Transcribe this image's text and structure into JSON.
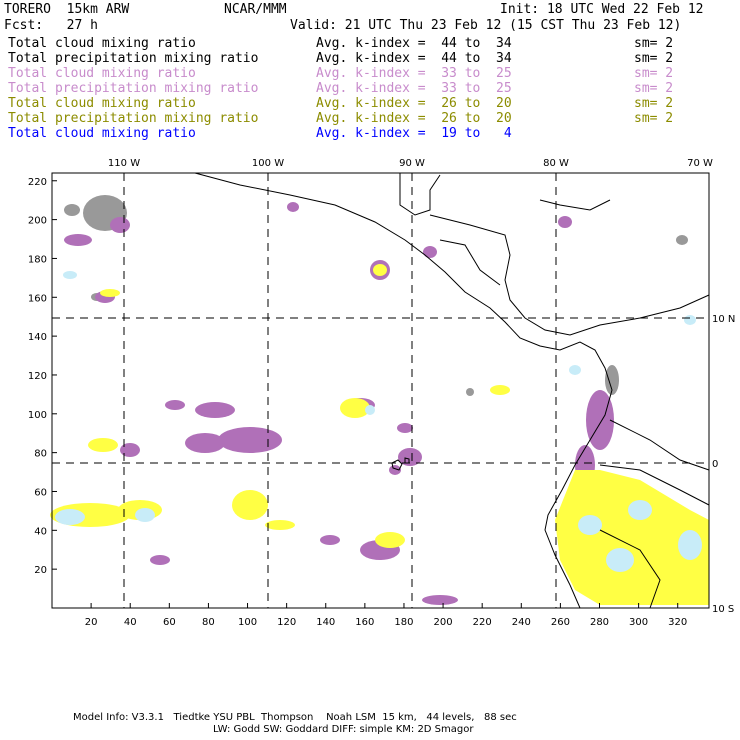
{
  "header": {
    "model": "TORERO  15km ARW",
    "org": "NCAR/MMM",
    "init": "Init: 18 UTC Wed 22 Feb 12",
    "fcst": "Fcst:   27 h",
    "valid": "Valid: 21 UTC Thu 23 Feb 12 (15 CST Thu 23 Feb 12)"
  },
  "legend": [
    {
      "field": "Total cloud mixing ratio",
      "range": "Avg. k-index =  44 to  34",
      "sm": "sm= 2",
      "color": "#000000"
    },
    {
      "field": "Total precipitation mixing ratio",
      "range": "Avg. k-index =  44 to  34",
      "sm": "sm= 2",
      "color": "#000000"
    },
    {
      "field": "Total cloud mixing ratio",
      "range": "Avg. k-index =  33 to  25",
      "sm": "sm= 2",
      "color": "#c88ccc"
    },
    {
      "field": "Total precipitation mixing ratio",
      "range": "Avg. k-index =  33 to  25",
      "sm": "sm= 2",
      "color": "#c88ccc"
    },
    {
      "field": "Total cloud mixing ratio",
      "range": "Avg. k-index =  26 to  20",
      "sm": "sm= 2",
      "color": "#8c8c00"
    },
    {
      "field": "Total precipitation mixing ratio",
      "range": "Avg. k-index =  26 to  20",
      "sm": "sm= 2",
      "color": "#8c8c00"
    },
    {
      "field": "Total cloud mixing ratio",
      "range": "Avg. k-index =  19 to   4",
      "sm": "",
      "color": "#0000ff"
    }
  ],
  "chart_data": {
    "type": "heatmap",
    "title": "Total cloud / precipitation mixing ratio by k-index layer",
    "x_ticks": [
      20,
      40,
      60,
      80,
      100,
      120,
      140,
      160,
      180,
      200,
      220,
      240,
      260,
      280,
      300,
      320
    ],
    "y_ticks": [
      20,
      40,
      60,
      80,
      100,
      120,
      140,
      160,
      180,
      200,
      220
    ],
    "xlim": [
      0,
      336
    ],
    "ylim": [
      0,
      224
    ],
    "lon_labels": [
      "110 W",
      "100 W",
      "90 W",
      "80 W",
      "70 W"
    ],
    "lat_labels": [
      "10 N",
      "0",
      "10 S"
    ],
    "grid": "dashed lat/lon lines",
    "colors": {
      "k44_34": "#999999",
      "k33_25": "#b070b8",
      "k26_20": "#ffff44",
      "k19_4": "#c8ecf8"
    }
  },
  "footer": {
    "line1": "Model Info: V3.3.1   Tiedtke YSU PBL  Thompson    Noah LSM  15 km,   44 levels,   88 sec",
    "line2": "LW: Godd SW: Goddard DIFF: simple KM: 2D Smagor"
  }
}
